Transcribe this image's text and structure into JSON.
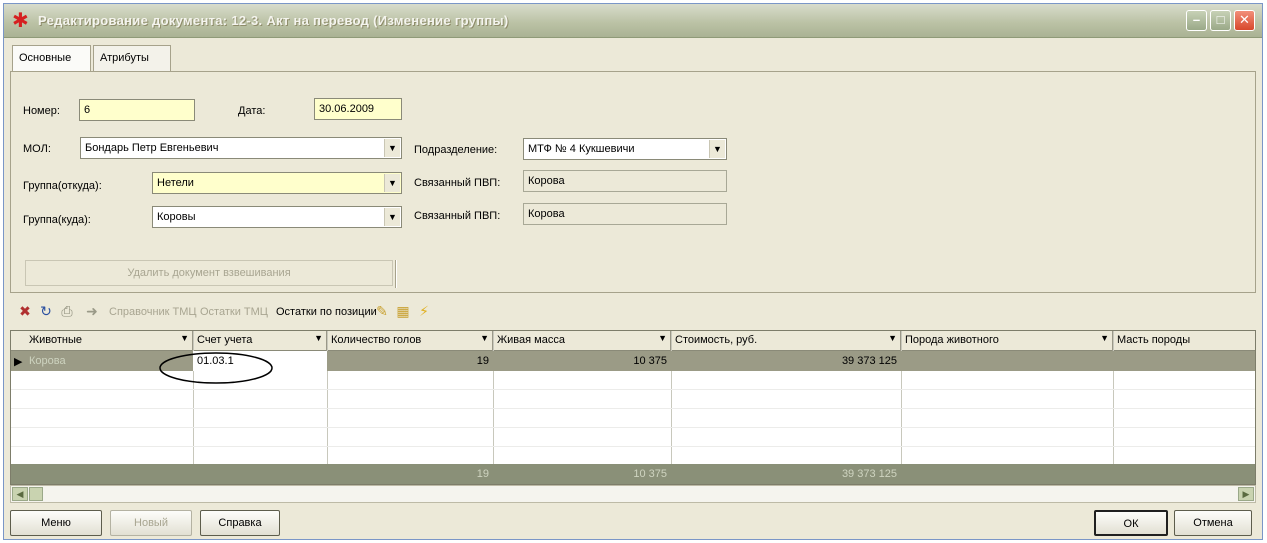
{
  "window": {
    "title": "Редактирование документа: 12-3. Акт на перевод (Изменение группы)",
    "buttons": [
      "minimize-icon",
      "restore-icon",
      "close-icon"
    ]
  },
  "tabs": [
    {
      "label": "Основные",
      "active": true
    },
    {
      "label": "Атрибуты",
      "active": false
    }
  ],
  "form": {
    "number_label": "Номер:",
    "number_value": "6",
    "date_label": "Дата:",
    "date_value": "30.06.2009",
    "mol_label": "МОЛ:",
    "mol_value": "Бондарь Петр Евгеньевич",
    "division_label": "Подразделение:",
    "division_value": "МТФ № 4 Кукшевичи",
    "group_from_label": "Группа(откуда):",
    "group_from_value": "Нетели",
    "linked_pvp_label_1": "Связанный ПВП:",
    "linked_pvp_value_1": "Корова",
    "group_to_label": "Группа(куда):",
    "group_to_value": "Коровы",
    "linked_pvp_label_2": "Связанный ПВП:",
    "linked_pvp_value_2": "Корова",
    "delete_weighing_button": "Удалить документ взвешивания"
  },
  "toolbar": {
    "icons": [
      "delete-row-icon",
      "refresh-icon",
      "print-icon",
      "export-icon"
    ],
    "links": [
      {
        "label": "Справочник ТМЦ",
        "enabled": false
      },
      {
        "label": "Остатки ТМЦ",
        "enabled": false
      },
      {
        "label": "Остатки по позиции",
        "enabled": true
      }
    ],
    "extra_icons": [
      "edit-icon",
      "table-icon",
      "lightning-icon"
    ]
  },
  "grid": {
    "columns": [
      "Животные",
      "Счет учета",
      "Количество голов",
      "Живая масса",
      "Стоимость, руб.",
      "Порода животного",
      "Масть породы"
    ],
    "rows": [
      [
        "Корова",
        "01.03.1",
        "19",
        "10 375",
        "39 373 125",
        "",
        ""
      ]
    ],
    "totals": [
      "",
      "",
      "19",
      "10 375",
      "39 373 125",
      "",
      ""
    ]
  },
  "footer": {
    "menu_button": "Меню",
    "new_button": "Новый",
    "help_button": "Справка",
    "ok_button": "ОК",
    "cancel_button": "Отмена"
  }
}
